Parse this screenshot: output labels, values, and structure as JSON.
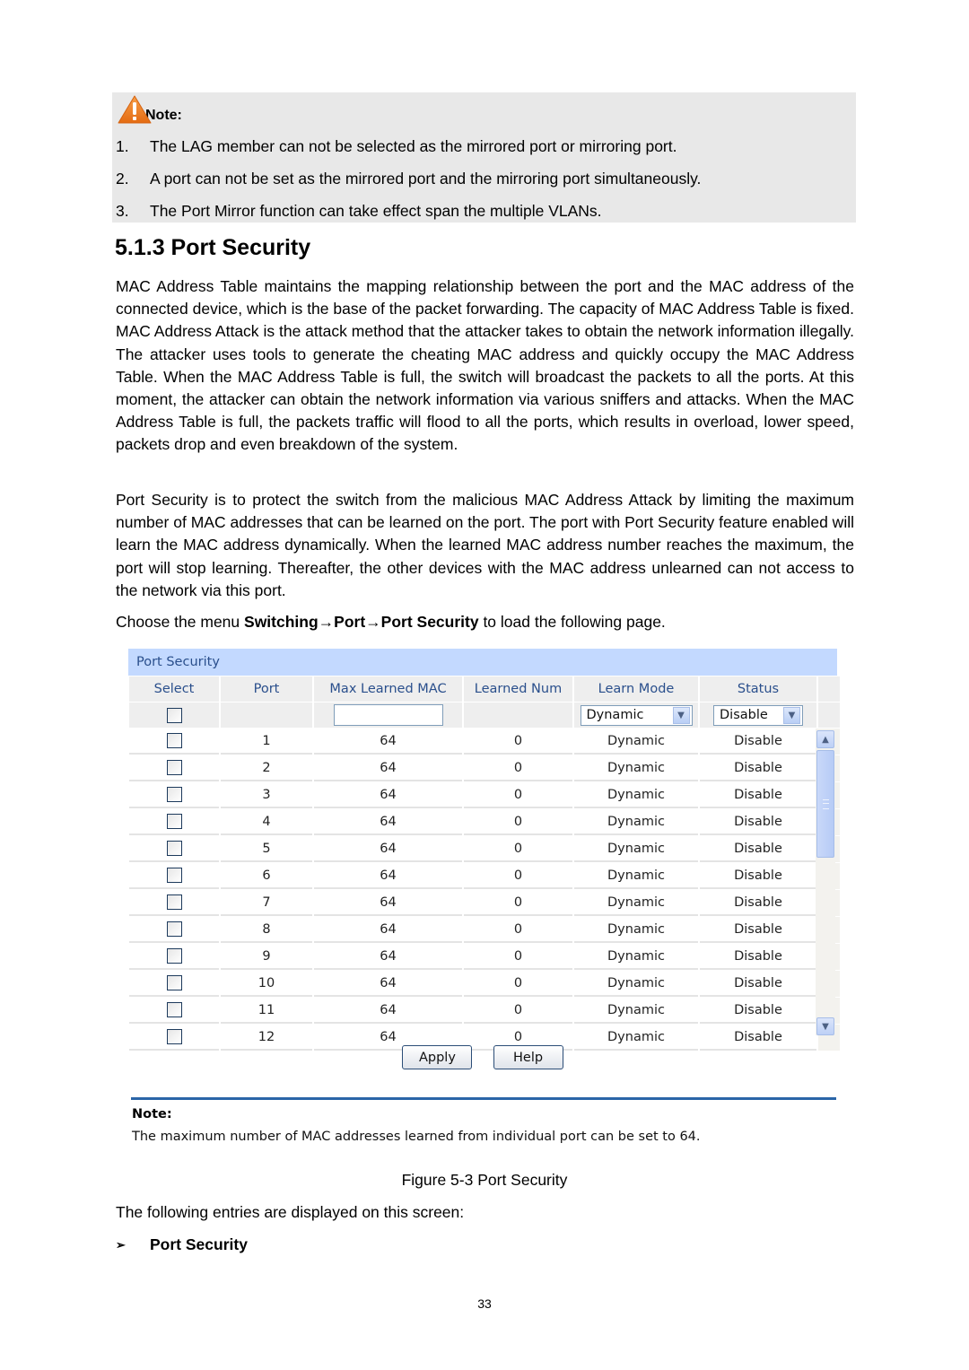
{
  "note": {
    "label": "Note:",
    "icon": "warning-icon",
    "items": [
      {
        "num": "1.",
        "text": "The LAG member can not be selected as the mirrored port or mirroring port."
      },
      {
        "num": "2.",
        "text": "A port can not be set as the mirrored port and the mirroring port simultaneously."
      },
      {
        "num": "3.",
        "text": "The Port Mirror function can take effect span the multiple VLANs."
      }
    ]
  },
  "section": {
    "title": "5.1.3 Port Security",
    "para1": "MAC Address Table maintains the mapping relationship between the port and the MAC address of the connected device, which is the base of the packet forwarding. The capacity of MAC Address Table is fixed. MAC Address Attack is the attack method that the attacker takes to obtain the network information illegally. The attacker uses tools to generate the cheating MAC address and quickly occupy the MAC Address Table. When the MAC Address Table is full, the switch will broadcast the packets to all the ports. At this moment, the attacker can obtain the network information via various sniffers and attacks. When the MAC Address Table is full, the packets traffic will flood to all the ports, which results in overload, lower speed, packets drop and even breakdown of the system.",
    "para2": "Port Security is to protect the switch from the malicious MAC Address Attack by limiting the maximum number of MAC addresses that can be learned on the port. The port with Port Security feature enabled will learn the MAC address dynamically. When the learned MAC address number reaches the maximum, the port will stop learning. Thereafter, the other devices with the MAC address unlearned can not access to the network via this port.",
    "menu_intro": "Choose the menu ",
    "menu_path": "Switching→Port→Port Security",
    "menu_outro": " to load the following page."
  },
  "figure": {
    "title": "Port Security",
    "columns": [
      "Select",
      "Port",
      "Max Learned MAC",
      "Learned Num",
      "Learn Mode",
      "Status"
    ],
    "controls": {
      "max_learned_value": "",
      "learn_mode_selected": "Dynamic",
      "status_selected": "Disable"
    },
    "rows": [
      {
        "port": "1",
        "max": "64",
        "learned": "0",
        "mode": "Dynamic",
        "status": "Disable"
      },
      {
        "port": "2",
        "max": "64",
        "learned": "0",
        "mode": "Dynamic",
        "status": "Disable"
      },
      {
        "port": "3",
        "max": "64",
        "learned": "0",
        "mode": "Dynamic",
        "status": "Disable"
      },
      {
        "port": "4",
        "max": "64",
        "learned": "0",
        "mode": "Dynamic",
        "status": "Disable"
      },
      {
        "port": "5",
        "max": "64",
        "learned": "0",
        "mode": "Dynamic",
        "status": "Disable"
      },
      {
        "port": "6",
        "max": "64",
        "learned": "0",
        "mode": "Dynamic",
        "status": "Disable"
      },
      {
        "port": "7",
        "max": "64",
        "learned": "0",
        "mode": "Dynamic",
        "status": "Disable"
      },
      {
        "port": "8",
        "max": "64",
        "learned": "0",
        "mode": "Dynamic",
        "status": "Disable"
      },
      {
        "port": "9",
        "max": "64",
        "learned": "0",
        "mode": "Dynamic",
        "status": "Disable"
      },
      {
        "port": "10",
        "max": "64",
        "learned": "0",
        "mode": "Dynamic",
        "status": "Disable"
      },
      {
        "port": "11",
        "max": "64",
        "learned": "0",
        "mode": "Dynamic",
        "status": "Disable"
      },
      {
        "port": "12",
        "max": "64",
        "learned": "0",
        "mode": "Dynamic",
        "status": "Disable"
      }
    ],
    "buttons": {
      "apply": "Apply",
      "help": "Help"
    },
    "note_label": "Note:",
    "note_text": "The maximum number of MAC addresses learned from individual port can be set to 64.",
    "colors": {
      "title_bar": "#c3d9ff",
      "header_text": "#2a4f8c",
      "divider": "#2a65a8"
    }
  },
  "caption": "Figure 5-3 Port Security",
  "entries_intro": "The following entries are displayed on this screen:",
  "bullet": {
    "icon": "arrow-bullet-icon",
    "glyph": "➢",
    "label": "Port Security"
  },
  "page_number": "33"
}
